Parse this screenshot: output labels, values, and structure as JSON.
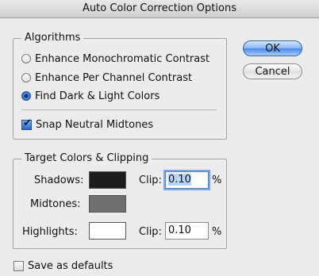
{
  "window": {
    "title": "Auto Color Correction Options"
  },
  "algorithms": {
    "title": "Algorithms",
    "options": [
      {
        "label": "Enhance Monochromatic Contrast",
        "selected": false
      },
      {
        "label": "Enhance Per Channel Contrast",
        "selected": false
      },
      {
        "label": "Find Dark & Light Colors",
        "selected": true
      }
    ],
    "snap_label": "Snap Neutral Midtones",
    "snap_checked": true
  },
  "buttons": {
    "ok": "OK",
    "cancel": "Cancel"
  },
  "target": {
    "title": "Target Colors & Clipping",
    "shadows": {
      "label": "Shadows:",
      "color": "#1c1c1c",
      "clip_label": "Clip:",
      "clip_value": "0.10",
      "unit": "%"
    },
    "midtones": {
      "label": "Midtones:",
      "color": "#6f6f6f"
    },
    "highlights": {
      "label": "Highlights:",
      "color": "#ffffff",
      "clip_label": "Clip:",
      "clip_value": "0.10",
      "unit": "%"
    }
  },
  "save_defaults": {
    "label": "Save as defaults",
    "checked": false
  }
}
